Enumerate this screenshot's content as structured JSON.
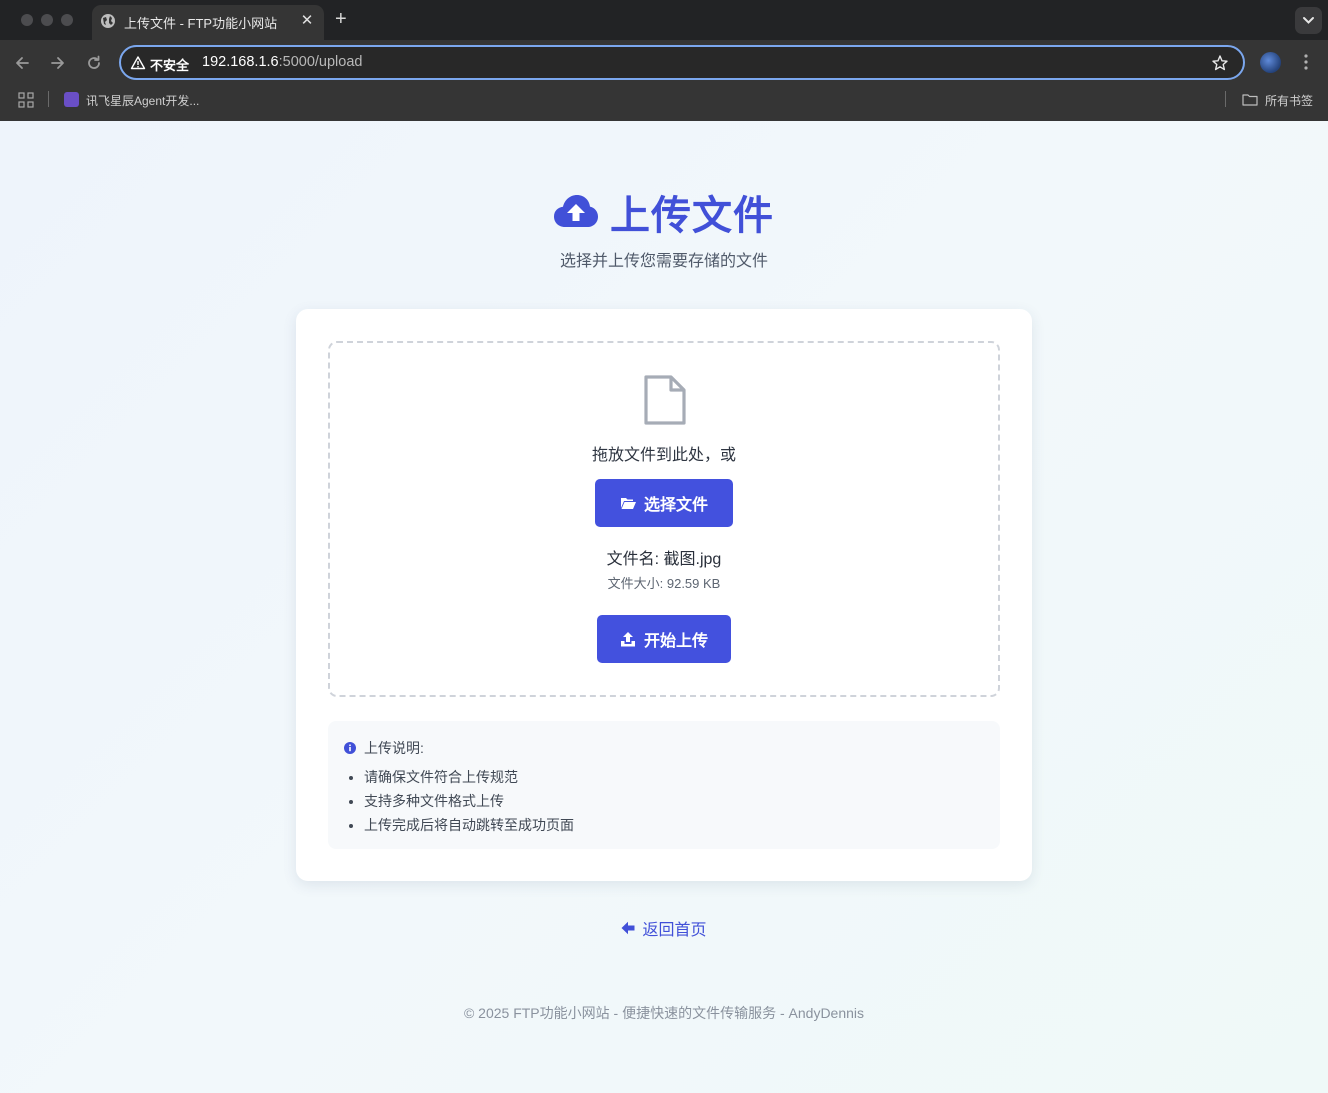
{
  "browser": {
    "tab_title": "上传文件 - FTP功能小网站",
    "tab_close": "✕",
    "new_tab": "+",
    "security_label": "不安全",
    "url_host": "192.168.1.6",
    "url_rest": ":5000/upload",
    "bookmark_label": "讯飞星辰Agent开发...",
    "all_bookmarks": "所有书签"
  },
  "hero": {
    "icon": "cloud-upload-icon",
    "title": "上传文件",
    "subtitle": "选择并上传您需要存储的文件"
  },
  "upload": {
    "drop_text": "拖放文件到此处，或",
    "choose_button": "选择文件",
    "file_name": "文件名: 截图.jpg",
    "file_size": "文件大小: 92.59 KB",
    "upload_button": "开始上传"
  },
  "notes": {
    "heading": "上传说明:",
    "items": [
      "请确保文件符合上传规范",
      "支持多种文件格式上传",
      "上传完成后将自动跳转至成功页面"
    ]
  },
  "back_link": "返回首页",
  "footer": "© 2025 FTP功能小网站 - 便捷快速的文件传输服务 - AndyDennis",
  "colors": {
    "accent": "#4351de",
    "title": "#4150d8",
    "chrome": "#353535",
    "omnibox_border": "#7ba7ee"
  }
}
